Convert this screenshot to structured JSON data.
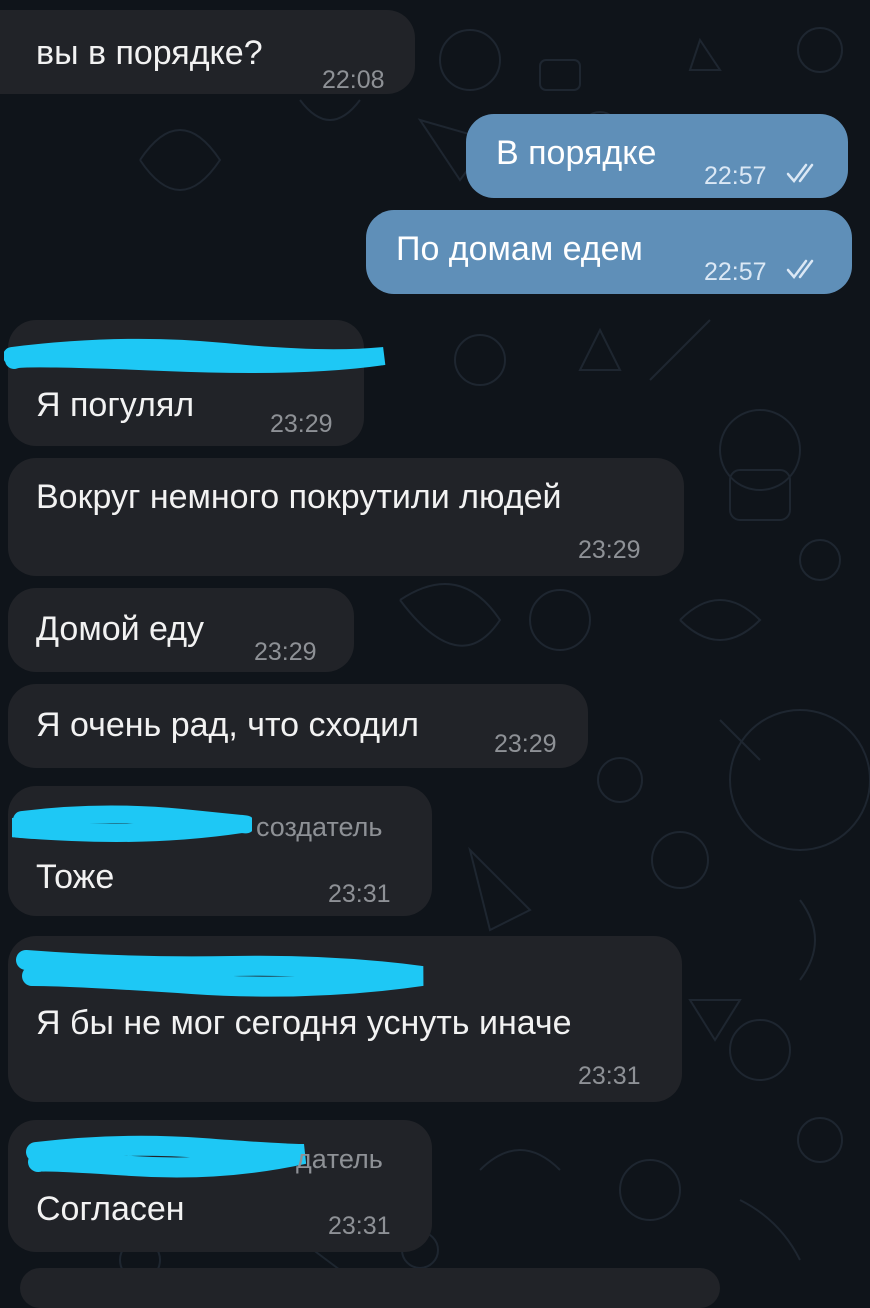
{
  "messages": [
    {
      "text": "вы в порядке?",
      "time": "22:08"
    },
    {
      "text": "В порядке",
      "time": "22:57"
    },
    {
      "text": "По домам едем",
      "time": "22:57"
    },
    {
      "text": "Я погулял",
      "time": "23:29"
    },
    {
      "text": "Вокруг немного покрутили людей",
      "time": "23:29"
    },
    {
      "text": "Домой еду",
      "time": "23:29"
    },
    {
      "text": "Я очень рад, что сходил",
      "time": "23:29"
    },
    {
      "text": "Тоже",
      "time": "23:31",
      "role": "создатель"
    },
    {
      "text": "Я бы не мог сегодня уснуть иначе",
      "time": "23:31"
    },
    {
      "text": "Согласен",
      "time": "23:31",
      "role": "дaтель"
    }
  ],
  "colors": {
    "background": "#0f141a",
    "incoming_bubble": "#212328",
    "outgoing_bubble": "#5f8fb8",
    "redaction": "#1ec8f5"
  }
}
